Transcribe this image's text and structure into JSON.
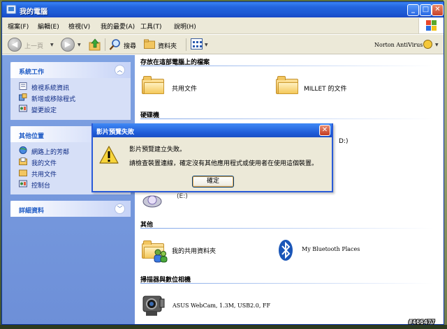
{
  "window": {
    "title": "我的電腦"
  },
  "menu": [
    "檔案(F)",
    "編輯(E)",
    "檢視(V)",
    "我的最愛(A)",
    "工具(T)",
    "說明(H)"
  ],
  "toolbar": {
    "back_label": "上一頁",
    "search_label": "搜尋",
    "folders_label": "資料夾",
    "norton_label": "Norton AntiVirus"
  },
  "left_pane": {
    "system_tasks": {
      "title": "系統工作",
      "items": [
        "檢視系統資訊",
        "新增或移除程式",
        "變更設定"
      ]
    },
    "other_places": {
      "title": "其他位置",
      "items": [
        "網路上的芳鄰",
        "我的文件",
        "共用文件",
        "控制台"
      ]
    },
    "details": {
      "title": "詳細資料"
    }
  },
  "content": {
    "files_section": {
      "title": "存放在這部電腦上的檔案",
      "items": [
        "共用文件",
        "MILLET 的文件"
      ]
    },
    "drives_section": {
      "title": "硬碟機",
      "partial_label": "D:)"
    },
    "removable_partial": "(E:)",
    "other_section": {
      "title": "其他",
      "items": [
        "我的共用資料夾",
        "My Bluetooth Places"
      ]
    },
    "scanners_section": {
      "title": "掃描器與數位相機",
      "items": [
        "ASUS WebCam, 1.3M, USB2.0, FF"
      ]
    }
  },
  "dialog": {
    "title": "影片預覽失敗",
    "message1": "影片預覽建立失敗。",
    "message2": "請檢查裝置連線，確定沒有其他應用程式或使用者在使用這個裝置。",
    "ok_label": "確定"
  },
  "watermark": "#466477"
}
